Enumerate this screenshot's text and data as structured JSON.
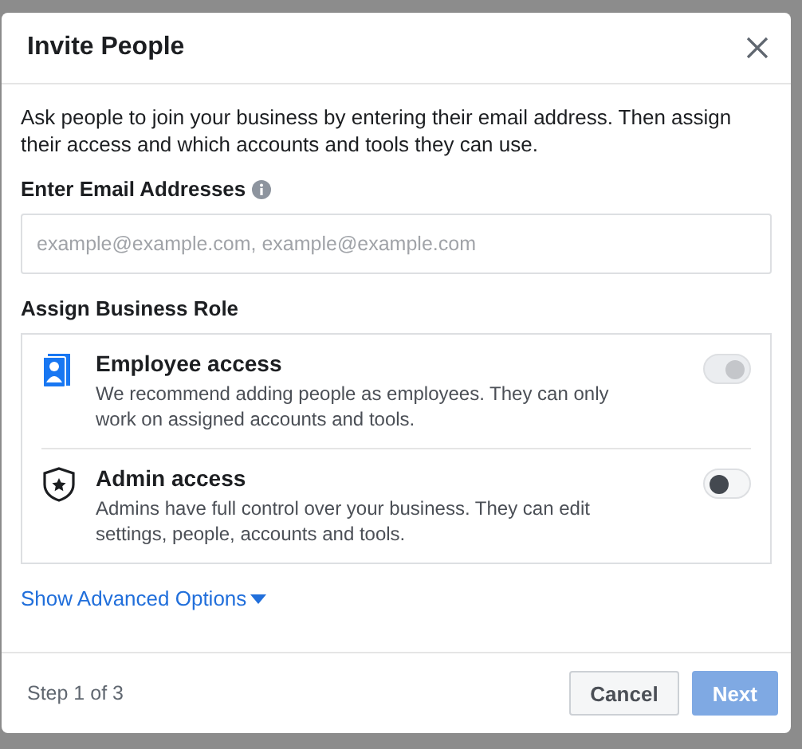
{
  "dialog": {
    "title": "Invite People",
    "intro": "Ask people to join your business by entering their email address. Then assign their access and which accounts and tools they can use.",
    "email_label": "Enter Email Addresses",
    "email_field": {
      "placeholder": "example@example.com, example@example.com"
    },
    "role_heading": "Assign Business Role",
    "roles": [
      {
        "kind": "employee",
        "name": "Employee access",
        "description": "We recommend adding people as employees. They can only work on assigned accounts and tools.",
        "on": true,
        "disabled": true
      },
      {
        "kind": "admin",
        "name": "Admin access",
        "description": "Admins have full control over your business. They can edit settings, people, accounts and tools.",
        "on": false,
        "disabled": false
      }
    ],
    "advanced_link": "Show Advanced Options",
    "step": "Step 1 of 3",
    "buttons": [
      {
        "label": "Cancel",
        "kind": "secondary",
        "disabled": false
      },
      {
        "label": "Next",
        "kind": "primary",
        "disabled": true
      }
    ]
  }
}
